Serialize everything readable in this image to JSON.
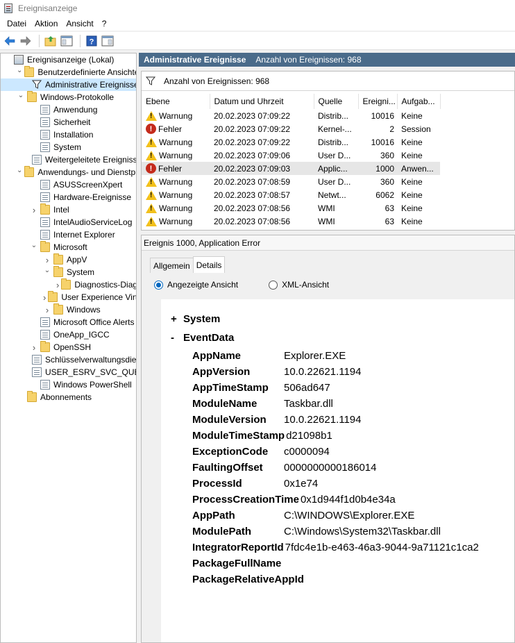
{
  "window": {
    "title": "Ereignisanzeige"
  },
  "menu": [
    "Datei",
    "Aktion",
    "Ansicht",
    "?"
  ],
  "tree": [
    {
      "label": "Ereignisanzeige (Lokal)",
      "indent": 0,
      "chev": "",
      "icon": "viewer"
    },
    {
      "label": "Benutzerdefinierte Ansichten",
      "indent": 1,
      "chev": "down",
      "icon": "folder"
    },
    {
      "label": "Administrative Ereignisse",
      "indent": 2,
      "chev": "",
      "icon": "filter",
      "selected": true
    },
    {
      "label": "Windows-Protokolle",
      "indent": 1,
      "chev": "down",
      "icon": "folder"
    },
    {
      "label": "Anwendung",
      "indent": 2,
      "chev": "",
      "icon": "log"
    },
    {
      "label": "Sicherheit",
      "indent": 2,
      "chev": "",
      "icon": "log"
    },
    {
      "label": "Installation",
      "indent": 2,
      "chev": "",
      "icon": "log"
    },
    {
      "label": "System",
      "indent": 2,
      "chev": "",
      "icon": "log"
    },
    {
      "label": "Weitergeleitete Ereignisse",
      "indent": 2,
      "chev": "",
      "icon": "log"
    },
    {
      "label": "Anwendungs- und Dienstprotokolle",
      "indent": 1,
      "chev": "down",
      "icon": "folder"
    },
    {
      "label": "ASUSScreenXpert",
      "indent": 2,
      "chev": "",
      "icon": "log"
    },
    {
      "label": "Hardware-Ereignisse",
      "indent": 2,
      "chev": "",
      "icon": "log"
    },
    {
      "label": "Intel",
      "indent": 2,
      "chev": "right",
      "icon": "folder"
    },
    {
      "label": "IntelAudioServiceLog",
      "indent": 2,
      "chev": "",
      "icon": "log"
    },
    {
      "label": "Internet Explorer",
      "indent": 2,
      "chev": "",
      "icon": "log"
    },
    {
      "label": "Microsoft",
      "indent": 2,
      "chev": "down",
      "icon": "folder"
    },
    {
      "label": "AppV",
      "indent": 3,
      "chev": "right",
      "icon": "folder"
    },
    {
      "label": "System",
      "indent": 3,
      "chev": "down",
      "icon": "folder"
    },
    {
      "label": "Diagnostics-Diagnostics",
      "indent": 4,
      "chev": "right",
      "icon": "folder"
    },
    {
      "label": "User Experience Virtualization",
      "indent": 3,
      "chev": "right",
      "icon": "folder"
    },
    {
      "label": "Windows",
      "indent": 3,
      "chev": "right",
      "icon": "folder"
    },
    {
      "label": "Microsoft Office Alerts",
      "indent": 2,
      "chev": "",
      "icon": "log"
    },
    {
      "label": "OneApp_IGCC",
      "indent": 2,
      "chev": "",
      "icon": "log"
    },
    {
      "label": "OpenSSH",
      "indent": 2,
      "chev": "right",
      "icon": "folder"
    },
    {
      "label": "Schlüsselverwaltungsdienst",
      "indent": 2,
      "chev": "",
      "icon": "log"
    },
    {
      "label": "USER_ESRV_SVC_QUEENCREEK",
      "indent": 2,
      "chev": "",
      "icon": "log"
    },
    {
      "label": "Windows PowerShell",
      "indent": 2,
      "chev": "",
      "icon": "log"
    },
    {
      "label": "Abonnements",
      "indent": 1,
      "chev": "",
      "icon": "folder"
    }
  ],
  "header": {
    "title": "Administrative Ereignisse",
    "count": "Anzahl von Ereignissen: 968"
  },
  "filter_label": "Anzahl von Ereignissen: 968",
  "columns": [
    "Ebene",
    "Datum und Uhrzeit",
    "Quelle",
    "Ereigni...",
    "Aufgab..."
  ],
  "events": [
    {
      "level": "Warnung",
      "type": "warn",
      "date": "20.02.2023 07:09:22",
      "source": "Distrib...",
      "id": "10016",
      "task": "Keine"
    },
    {
      "level": "Fehler",
      "type": "err",
      "date": "20.02.2023 07:09:22",
      "source": "Kernel-...",
      "id": "2",
      "task": "Session"
    },
    {
      "level": "Warnung",
      "type": "warn",
      "date": "20.02.2023 07:09:22",
      "source": "Distrib...",
      "id": "10016",
      "task": "Keine"
    },
    {
      "level": "Warnung",
      "type": "warn",
      "date": "20.02.2023 07:09:06",
      "source": "User D...",
      "id": "360",
      "task": "Keine"
    },
    {
      "level": "Fehler",
      "type": "err",
      "date": "20.02.2023 07:09:03",
      "source": "Applic...",
      "id": "1000",
      "task": "Anwen...",
      "selected": true
    },
    {
      "level": "Warnung",
      "type": "warn",
      "date": "20.02.2023 07:08:59",
      "source": "User D...",
      "id": "360",
      "task": "Keine"
    },
    {
      "level": "Warnung",
      "type": "warn",
      "date": "20.02.2023 07:08:57",
      "source": "Netwt...",
      "id": "6062",
      "task": "Keine"
    },
    {
      "level": "Warnung",
      "type": "warn",
      "date": "20.02.2023 07:08:56",
      "source": "WMI",
      "id": "63",
      "task": "Keine"
    },
    {
      "level": "Warnung",
      "type": "warn",
      "date": "20.02.2023 07:08:56",
      "source": "WMI",
      "id": "63",
      "task": "Keine"
    }
  ],
  "detail": {
    "title": "Ereignis 1000, Application Error",
    "tabs": [
      "Allgemein",
      "Details"
    ],
    "radio_friendly": "Angezeigte Ansicht",
    "radio_xml": "XML-Ansicht",
    "section_system": "System",
    "section_eventdata": "EventData",
    "fields": [
      {
        "k": "AppName",
        "v": "Explorer.EXE"
      },
      {
        "k": "AppVersion",
        "v": "10.0.22621.1194"
      },
      {
        "k": "AppTimeStamp",
        "v": "506ad647"
      },
      {
        "k": "ModuleName",
        "v": "Taskbar.dll"
      },
      {
        "k": "ModuleVersion",
        "v": "10.0.22621.1194"
      },
      {
        "k": "ModuleTimeStamp",
        "v": "d21098b1"
      },
      {
        "k": "ExceptionCode",
        "v": "c0000094"
      },
      {
        "k": "FaultingOffset",
        "v": "0000000000186014"
      },
      {
        "k": "ProcessId",
        "v": "0x1e74"
      },
      {
        "k": "ProcessCreationTime",
        "v": "0x1d944f1d0b4e34a"
      },
      {
        "k": "AppPath",
        "v": "C:\\WINDOWS\\Explorer.EXE"
      },
      {
        "k": "ModulePath",
        "v": "C:\\Windows\\System32\\Taskbar.dll"
      },
      {
        "k": "IntegratorReportId",
        "v": "7fdc4e1b-e463-46a3-9044-9a71121c1ca2"
      },
      {
        "k": "PackageFullName",
        "v": ""
      },
      {
        "k": "PackageRelativeAppId",
        "v": ""
      }
    ]
  }
}
